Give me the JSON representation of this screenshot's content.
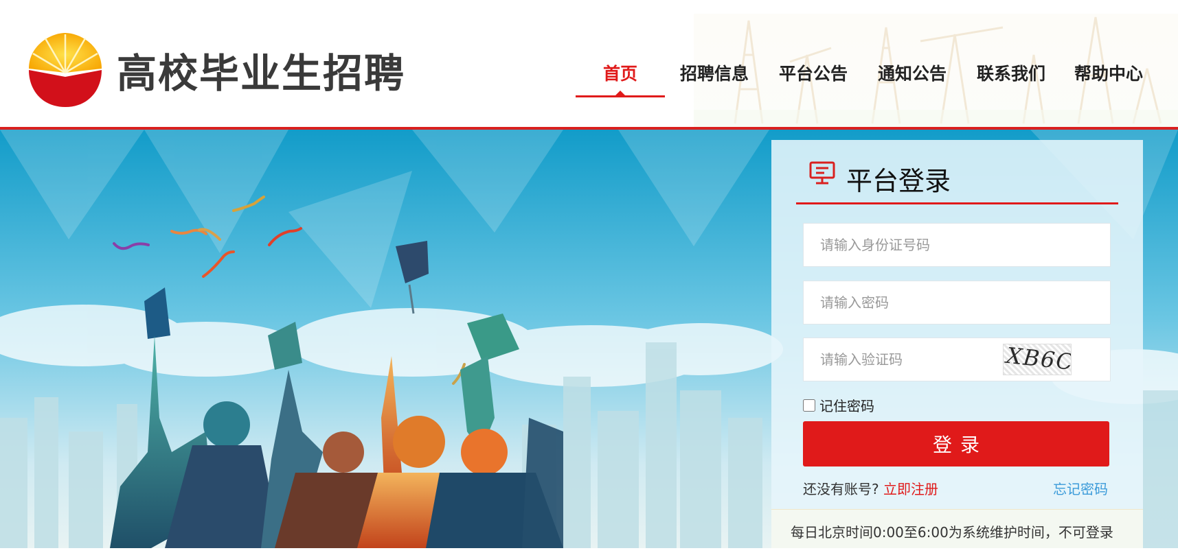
{
  "header": {
    "site_title": "高校毕业生招聘",
    "logo": "petrochina-sunflower-logo",
    "nav": [
      {
        "label": "首页",
        "active": true
      },
      {
        "label": "招聘信息",
        "active": false
      },
      {
        "label": "平台公告",
        "active": false
      },
      {
        "label": "通知公告",
        "active": false
      },
      {
        "label": "联系我们",
        "active": false
      },
      {
        "label": "帮助中心",
        "active": false
      }
    ]
  },
  "banner": {
    "scene": "graduates-throwing-caps-over-city-skyline"
  },
  "login": {
    "icon": "monitor-icon",
    "title": "平台登录",
    "id_placeholder": "请输入身份证号码",
    "password_placeholder": "请输入密码",
    "captcha_placeholder": "请输入验证码",
    "captcha_text": "XB6C",
    "remember_label": "记住密码",
    "remember_checked": false,
    "submit_label": "登录",
    "no_account_text": "还没有账号?",
    "register_link": "立即注册",
    "forgot_link": "忘记密码",
    "maintenance_notice": "每日北京时间0:00至6:00为系统维护时间，不可登录"
  },
  "colors": {
    "brand_red": "#e01a1a",
    "link_blue": "#3a9ad9",
    "header_line": "#d9201f",
    "sky_blue": "#1aa3d0"
  }
}
